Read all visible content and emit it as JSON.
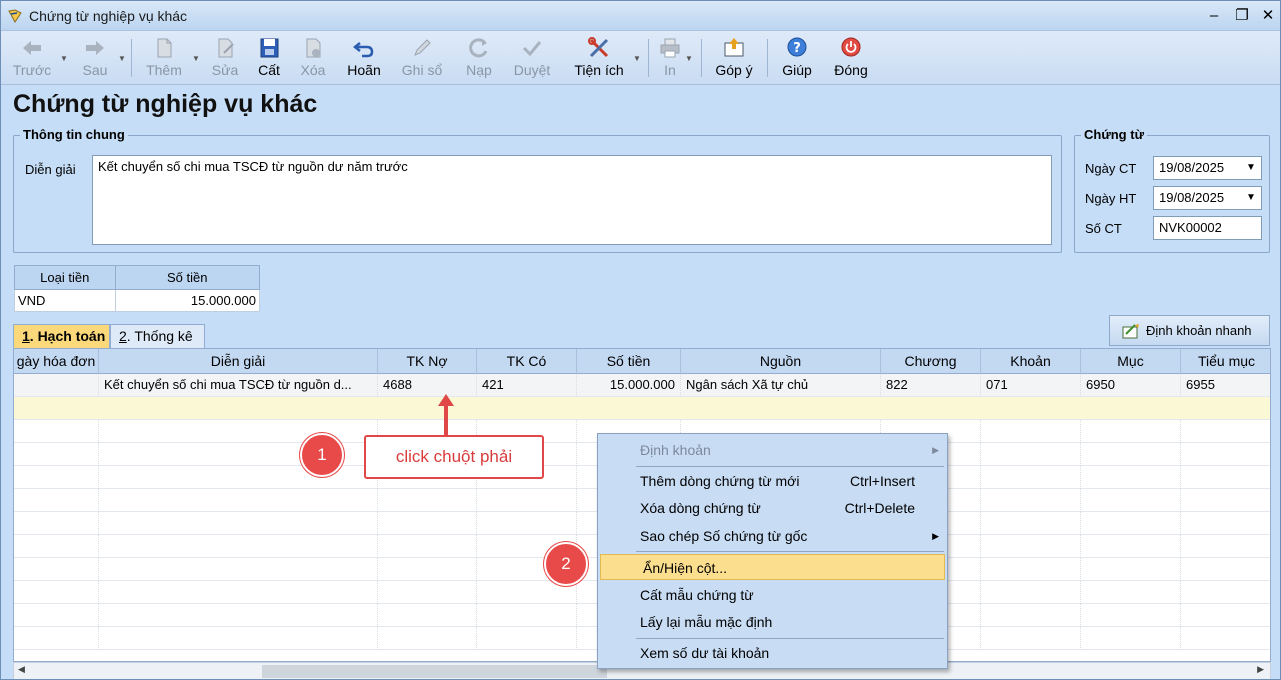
{
  "window": {
    "title": "Chứng từ nghiệp vụ khác",
    "minimize": "–",
    "restore": "❐",
    "close": "✕"
  },
  "toolbar": [
    {
      "id": "truoc",
      "label": "Trước",
      "icon": "arrow-left-icon",
      "enabled": false
    },
    {
      "id": "sau",
      "label": "Sau",
      "icon": "arrow-right-icon",
      "enabled": false
    },
    {
      "id": "them",
      "label": "Thêm",
      "icon": "new-doc-icon",
      "enabled": false
    },
    {
      "id": "sua",
      "label": "Sửa",
      "icon": "edit-doc-icon",
      "enabled": false
    },
    {
      "id": "cat",
      "label": "Cất",
      "icon": "save-icon",
      "enabled": true
    },
    {
      "id": "xoa",
      "label": "Xóa",
      "icon": "delete-doc-icon",
      "enabled": false
    },
    {
      "id": "hoan",
      "label": "Hoãn",
      "icon": "undo-icon",
      "enabled": true
    },
    {
      "id": "ghiso",
      "label": "Ghi sổ",
      "icon": "pencil-icon",
      "enabled": false
    },
    {
      "id": "nap",
      "label": "Nạp",
      "icon": "refresh-icon",
      "enabled": false
    },
    {
      "id": "duyet",
      "label": "Duyệt",
      "icon": "check-icon",
      "enabled": false
    },
    {
      "id": "tienich",
      "label": "Tiện ích",
      "icon": "tools-icon",
      "enabled": true
    },
    {
      "id": "in",
      "label": "In",
      "icon": "printer-icon",
      "enabled": false
    },
    {
      "id": "gopy",
      "label": "Góp ý",
      "icon": "feedback-icon",
      "enabled": true
    },
    {
      "id": "giup",
      "label": "Giúp",
      "icon": "help-icon",
      "enabled": true
    },
    {
      "id": "dong",
      "label": "Đóng",
      "icon": "power-icon",
      "enabled": true
    }
  ],
  "page_title": "Chứng từ nghiệp vụ khác",
  "general": {
    "legend": "Thông tin chung",
    "dien_giai_label": "Diễn giải",
    "dien_giai_value": "Kết chuyển số chi mua TSCĐ từ nguồn dư năm trước"
  },
  "voucher": {
    "legend": "Chứng từ",
    "ngay_ct_label": "Ngày CT",
    "ngay_ct_value": "19/08/2025",
    "ngay_ht_label": "Ngày HT",
    "ngay_ht_value": "19/08/2025",
    "so_ct_label": "Số CT",
    "so_ct_value": "NVK00002"
  },
  "money": {
    "col_currency": "Loại tiền",
    "col_amount": "Số tiền",
    "currency": "VND",
    "amount": "15.000.000"
  },
  "tabs": [
    {
      "key": "1",
      "rest": ". Hạch toán",
      "active": true
    },
    {
      "key": "2",
      "rest": ". Thống kê",
      "active": false
    }
  ],
  "quick_button": "Định khoản nhanh",
  "grid": {
    "columns": [
      "gày hóa đơn",
      "Diễn giải",
      "TK Nợ",
      "TK Có",
      "Số tiền",
      "Nguồn",
      "Chương",
      "Khoản",
      "Mục",
      "Tiểu mục"
    ],
    "rows": [
      [
        "",
        "Kết chuyển số chi mua TSCĐ từ nguồn d...",
        "4688",
        "421",
        "15.000.000",
        "Ngân sách Xã tự chủ",
        "822",
        "071",
        "6950",
        "6955"
      ]
    ]
  },
  "context_menu": [
    {
      "label": "Định khoản",
      "shortcut": "",
      "submenu": true,
      "disabled": true,
      "highlighted": false
    },
    {
      "label": "Thêm dòng chứng từ mới",
      "shortcut": "Ctrl+Insert",
      "submenu": false,
      "disabled": false,
      "highlighted": false
    },
    {
      "label": "Xóa dòng chứng từ",
      "shortcut": "Ctrl+Delete",
      "submenu": false,
      "disabled": false,
      "highlighted": false
    },
    {
      "label": "Sao chép Số chứng từ gốc",
      "shortcut": "",
      "submenu": true,
      "disabled": false,
      "highlighted": false
    },
    {
      "label": "Ẩn/Hiện cột...",
      "shortcut": "",
      "submenu": false,
      "disabled": false,
      "highlighted": true
    },
    {
      "label": "Cất mẫu chứng từ",
      "shortcut": "",
      "submenu": false,
      "disabled": false,
      "highlighted": false
    },
    {
      "label": "Lấy lại mẫu mặc định",
      "shortcut": "",
      "submenu": false,
      "disabled": false,
      "highlighted": false
    },
    {
      "label": "Xem số dư tài khoản",
      "shortcut": "",
      "submenu": false,
      "disabled": false,
      "highlighted": false
    }
  ],
  "annotations": {
    "step1": "1",
    "step2": "2",
    "callout": "click chuột phải"
  },
  "colors": {
    "accent_red": "#e84a4a",
    "highlight": "#fbdf8e",
    "header_bg": "#c3d9f2"
  }
}
